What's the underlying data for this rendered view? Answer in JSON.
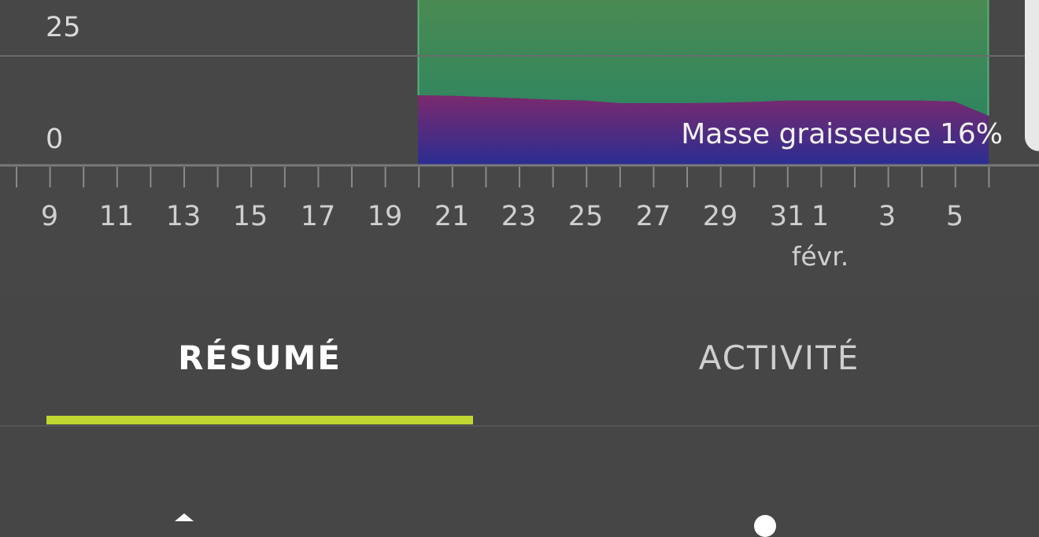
{
  "chart": {
    "y_ticks": [
      "25",
      "0"
    ],
    "x_ticks": [
      "9",
      "11",
      "13",
      "15",
      "17",
      "19",
      "21",
      "23",
      "25",
      "27",
      "29",
      "31",
      "1",
      "3",
      "5"
    ],
    "month_label": "févr.",
    "overlay_label": "Masse graisseuse 16%"
  },
  "chart_data": {
    "type": "area",
    "x": [
      "20",
      "21",
      "22",
      "23",
      "24",
      "25",
      "26",
      "27",
      "28",
      "29",
      "30",
      "31",
      "1",
      "2",
      "3",
      "4",
      "5",
      "6"
    ],
    "series": [
      {
        "values": [
          16,
          15.9,
          15.6,
          15.3,
          15.0,
          14.8,
          14.2,
          14.2,
          14.2,
          14.3,
          14.5,
          14.8,
          14.8,
          14.8,
          14.8,
          14.8,
          14.6,
          11.3
        ]
      },
      {
        "values": [
          null,
          null,
          null,
          null,
          null,
          null,
          null,
          null,
          null,
          null,
          null,
          null,
          null,
          null,
          null,
          null,
          null,
          null
        ]
      }
    ],
    "xlabel": "",
    "ylabel": "",
    "y_ticks_shown": [
      0,
      25
    ],
    "x_range": [
      "9",
      "6"
    ],
    "colors": {
      "fat_top": "#7b2a6d",
      "fat_bottom": "#2a2d92",
      "rest_top": "#4a8a52",
      "rest_bottom": "#2f8660"
    },
    "grid": true
  },
  "tabs": {
    "items": [
      {
        "label": "RÉSUMÉ",
        "active": true
      },
      {
        "label": "ACTIVITÉ",
        "active": false
      }
    ],
    "accent": "#bfd630"
  },
  "icons": [
    "up-arrow-icon",
    "circle-icon"
  ]
}
